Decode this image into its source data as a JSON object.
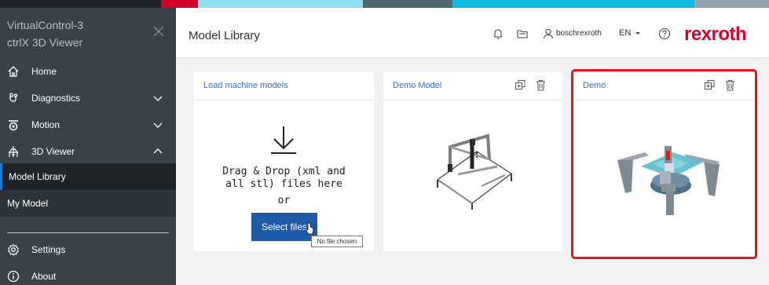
{
  "colors": {
    "colorbar": [
      "#1d2329",
      "#d6002a",
      "#8ce0f2",
      "#4f6675",
      "#0ebbe0",
      "#8fa3b0"
    ],
    "brand_red": "#d6002a",
    "accent_blue": "#1f5aa8",
    "highlight_red": "#e3161e"
  },
  "sidebar": {
    "title_line1": "VirtualControl-3",
    "title_line2": "ctrlX 3D Viewer",
    "items": [
      {
        "label": "Home",
        "icon": "home-icon"
      },
      {
        "label": "Diagnostics",
        "icon": "diagnostics-icon"
      },
      {
        "label": "Motion",
        "icon": "motion-icon"
      },
      {
        "label": "3D Viewer",
        "icon": "3d-viewer-icon"
      }
    ],
    "subitems": [
      {
        "label": "Model Library",
        "active": true
      },
      {
        "label": "My Model",
        "active": false
      }
    ],
    "bottom_items": [
      {
        "label": "Settings",
        "icon": "settings-icon"
      },
      {
        "label": "About",
        "icon": "info-icon"
      }
    ]
  },
  "header": {
    "title": "Model Library",
    "username": "boschrexroth",
    "language": "EN",
    "logo_text": "rexroth"
  },
  "cards": {
    "load": {
      "title": "Load machine models",
      "drop_line1": "Drag & Drop (xml and",
      "drop_line2": "all stl) files here",
      "drop_line3": "or",
      "button_label": "Select files",
      "tooltip": "No file chosen"
    },
    "demo_model": {
      "title": "Demo Model"
    },
    "demo": {
      "title": "Demo"
    }
  }
}
